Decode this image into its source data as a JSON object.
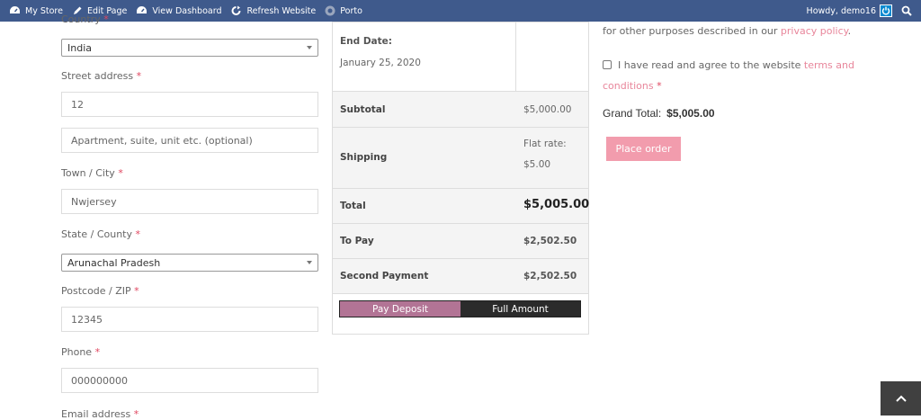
{
  "adminbar": {
    "my_store": "My Store",
    "edit_page": "Edit Page",
    "view_dashboard": "View Dashboard",
    "refresh_website": "Refresh Website",
    "theme": "Porto",
    "howdy": "Howdy, demo16"
  },
  "form": {
    "country_label": "Country",
    "country_value": "India",
    "street_label": "Street address",
    "street_value": "12",
    "apartment_placeholder": "Apartment, suite, unit etc. (optional)",
    "town_label": "Town / City",
    "town_value": "Nwjersey",
    "state_label": "State / County",
    "state_value": "Arunachal Pradesh",
    "postcode_label": "Postcode / ZIP",
    "postcode_value": "12345",
    "phone_label": "Phone",
    "phone_value": "000000000",
    "email_label": "Email address",
    "required_mark": "*"
  },
  "order": {
    "end_date_label": "End Date:",
    "end_date_value": "January 25, 2020",
    "rows": [
      {
        "label": "Subtotal",
        "value": "$5,000.00"
      },
      {
        "label": "Shipping",
        "value_line1": "Flat rate:",
        "value_line2": "$5.00"
      },
      {
        "label": "Total",
        "value": "$5,005.00"
      },
      {
        "label": "To Pay",
        "value": "$2,502.50"
      },
      {
        "label": "Second Payment",
        "value": "$2,502.50"
      }
    ],
    "pay_deposit": "Pay Deposit",
    "full_amount": "Full Amount"
  },
  "summary": {
    "privacy_prefix": "for other purposes described in our ",
    "privacy_link": "privacy policy",
    "privacy_suffix": ".",
    "terms_text": "I have read and agree to the website ",
    "terms_link_1": "terms and",
    "terms_link_2": "conditions",
    "required_mark": "*",
    "grand_total_label": "Grand Total:",
    "grand_total_value": "$5,005.00",
    "place_order": "Place order"
  },
  "colors": {
    "adminbar": "#3f5a8c",
    "accent_pink": "#f29cad",
    "deposit": "#b27495"
  }
}
